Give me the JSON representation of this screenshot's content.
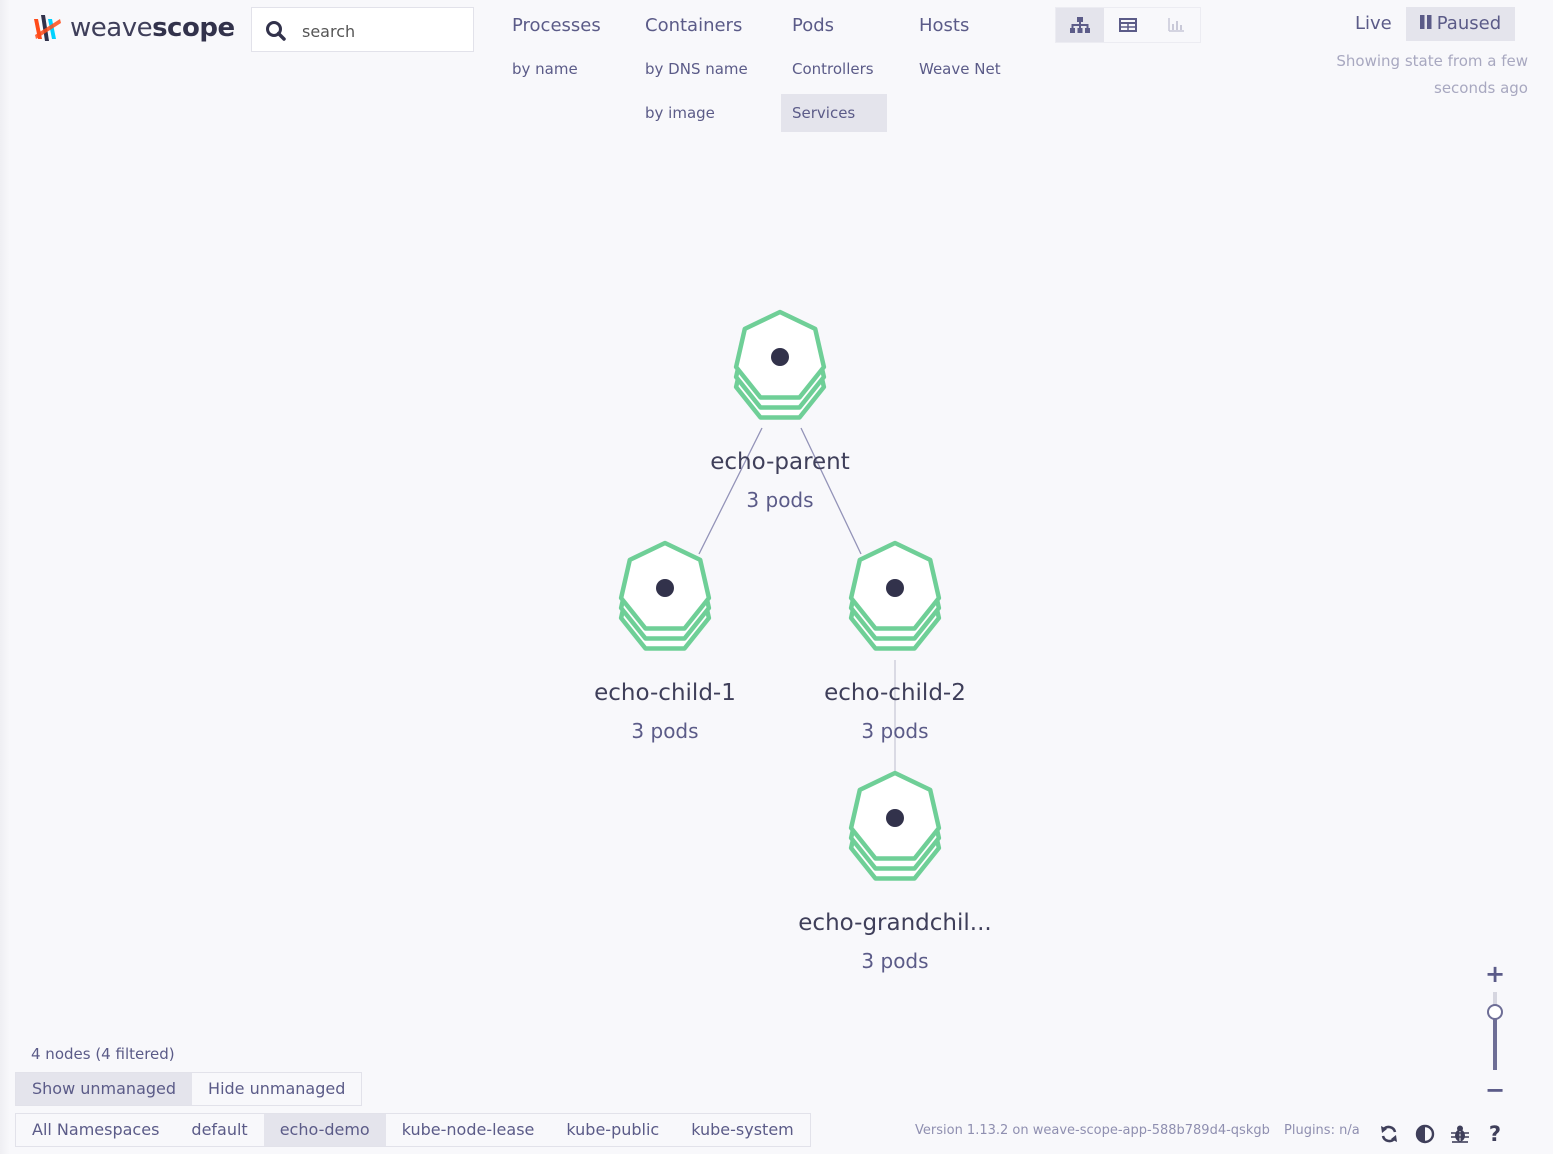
{
  "app": {
    "brand_light": "weave",
    "brand_bold": "scope",
    "brand_colors": [
      "#ff4b19",
      "#00d2ff",
      "#32324b"
    ]
  },
  "search": {
    "placeholder": "search"
  },
  "topology_menu": [
    {
      "label": "Processes",
      "sub": [
        "by name"
      ]
    },
    {
      "label": "Containers",
      "sub": [
        "by DNS name",
        "by image"
      ]
    },
    {
      "label": "Pods",
      "sub": [
        "Controllers",
        "Services"
      ],
      "active_sub": "Services"
    },
    {
      "label": "Hosts",
      "sub": [
        "Weave Net"
      ]
    }
  ],
  "view_modes": [
    {
      "name": "graph-view",
      "icon": "topology-graph-icon",
      "active": true
    },
    {
      "name": "table-view",
      "icon": "table-icon",
      "active": false
    },
    {
      "name": "resource-view",
      "icon": "bar-chart-icon",
      "active": false
    }
  ],
  "pause": {
    "live_label": "Live",
    "paused_label": "Paused",
    "state": "paused",
    "info_line1": "Showing state from a few",
    "info_line2": "seconds ago"
  },
  "graph": {
    "nodes": [
      {
        "id": "echo-parent",
        "label": "echo-parent",
        "sub": "3 pods"
      },
      {
        "id": "echo-child-1",
        "label": "echo-child-1",
        "sub": "3 pods"
      },
      {
        "id": "echo-child-2",
        "label": "echo-child-2",
        "sub": "3 pods"
      },
      {
        "id": "echo-grandchild",
        "label": "echo-grandchil...",
        "sub": "3 pods"
      }
    ],
    "edges": [
      [
        "echo-parent",
        "echo-child-1"
      ],
      [
        "echo-parent",
        "echo-child-2"
      ],
      [
        "echo-child-2",
        "echo-grandchild"
      ]
    ],
    "node_color": "#6fcf97"
  },
  "footer": {
    "node_count": "4 nodes (4 filtered)",
    "unmanaged": [
      "Show unmanaged",
      "Hide unmanaged"
    ],
    "unmanaged_active": "Show unmanaged",
    "namespaces": [
      "All Namespaces",
      "default",
      "echo-demo",
      "kube-node-lease",
      "kube-public",
      "kube-system"
    ],
    "namespace_active": "echo-demo",
    "version": "Version 1.13.2 on weave-scope-app-588b789d4-qskgb",
    "plugins": "Plugins: n/a",
    "icons": [
      "refresh-icon",
      "contrast-icon",
      "bug-icon",
      "help-icon"
    ]
  },
  "zoom": {
    "plus": "+",
    "minus": "−",
    "level": 0.72
  }
}
